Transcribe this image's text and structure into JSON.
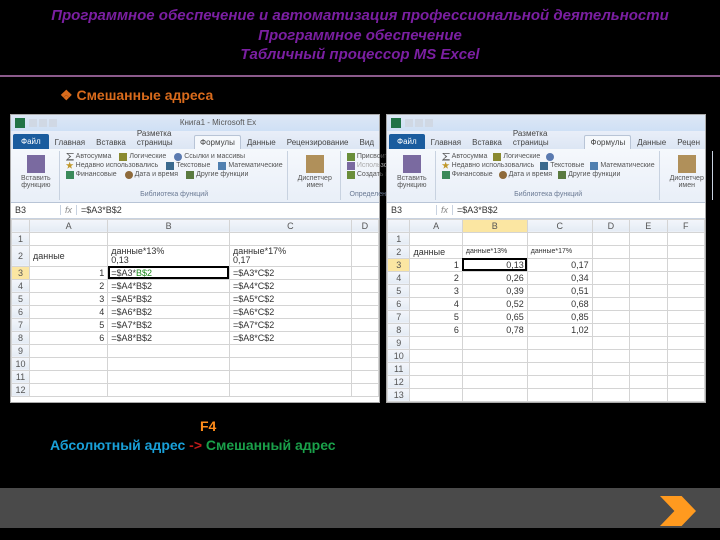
{
  "header": {
    "line1": "Программное обеспечение и автоматизация профессиональной деятельности",
    "line2": "Программное обеспечение",
    "line3": "Табличный процессор  MS Excel"
  },
  "subtitle": "Смешанные адреса",
  "excel_common": {
    "window_title": "Книга1 - Microsoft Ex",
    "tab_file": "Файл",
    "tabs": [
      "Главная",
      "Вставка",
      "Разметка страницы",
      "Формулы",
      "Данные",
      "Рецензирование",
      "Вид"
    ],
    "tabs_short": [
      "Главная",
      "Вставка",
      "Разметка страницы",
      "Формулы",
      "Данные",
      "Рецен"
    ],
    "active_tab": "Формулы",
    "ribbon": {
      "insert_fn": "Вставить\nфункцию",
      "autosum": "Автосумма",
      "recent": "Недавно использовались",
      "financial": "Финансовые",
      "logical": "Логические",
      "text": "Текстовые",
      "datetime": "Дата и время",
      "lookup": "Ссылки и массивы",
      "math": "Математические",
      "more": "Другие функции",
      "lib_label": "Библиотека функций",
      "name_mgr": "Диспетчер\nимен",
      "assign": "Присвоить",
      "use_in": "Использов",
      "create": "Создать из",
      "names_label": "Определенн"
    },
    "fx_label": "fx"
  },
  "left": {
    "namebox": "B3",
    "formula": "=$A3*B$2",
    "cols": [
      "",
      "A",
      "B",
      "C",
      "D"
    ],
    "rows": [
      {
        "r": "1",
        "a": "",
        "b": "",
        "c": "",
        "d": ""
      },
      {
        "r": "2",
        "a": "данные",
        "b": "данные*13%",
        "c": "данные*17%",
        "d": ""
      },
      {
        "r": "3",
        "a": "1",
        "b": "=$A3*B$2",
        "c": "=$A3*C$2",
        "d": ""
      },
      {
        "r": "4",
        "a": "2",
        "b": "=$A4*B$2",
        "c": "=$A4*C$2",
        "d": ""
      },
      {
        "r": "5",
        "a": "3",
        "b": "=$A5*B$2",
        "c": "=$A5*C$2",
        "d": ""
      },
      {
        "r": "6",
        "a": "4",
        "b": "=$A6*B$2",
        "c": "=$A6*C$2",
        "d": ""
      },
      {
        "r": "7",
        "a": "5",
        "b": "=$A7*B$2",
        "c": "=$A7*C$2",
        "d": ""
      },
      {
        "r": "8",
        "a": "6",
        "b": "=$A8*B$2",
        "c": "=$A8*C$2",
        "d": ""
      },
      {
        "r": "9",
        "a": "",
        "b": "",
        "c": "",
        "d": ""
      },
      {
        "r": "10",
        "a": "",
        "b": "",
        "c": "",
        "d": ""
      },
      {
        "r": "11",
        "a": "",
        "b": "",
        "c": "",
        "d": ""
      },
      {
        "r": "12",
        "a": "",
        "b": "",
        "c": "",
        "d": ""
      }
    ],
    "b2_extra": "0,13",
    "c2_extra": "0,17"
  },
  "right": {
    "namebox": "B3",
    "formula": "=$A3*B$2",
    "cols": [
      "",
      "A",
      "B",
      "C",
      "D",
      "E",
      "F"
    ],
    "rows": [
      {
        "r": "1",
        "a": "",
        "b": "",
        "c": "",
        "d": "",
        "e": "",
        "f": ""
      },
      {
        "r": "2",
        "a": "данные",
        "b": "данные*13%",
        "c": "данные*17%",
        "d": "",
        "e": "",
        "f": ""
      },
      {
        "r": "3",
        "a": "1",
        "b": "0,13",
        "c": "0,17",
        "d": "",
        "e": "",
        "f": ""
      },
      {
        "r": "4",
        "a": "2",
        "b": "0,26",
        "c": "0,34",
        "d": "",
        "e": "",
        "f": ""
      },
      {
        "r": "5",
        "a": "3",
        "b": "0,39",
        "c": "0,51",
        "d": "",
        "e": "",
        "f": ""
      },
      {
        "r": "6",
        "a": "4",
        "b": "0,52",
        "c": "0,68",
        "d": "",
        "e": "",
        "f": ""
      },
      {
        "r": "7",
        "a": "5",
        "b": "0,65",
        "c": "0,85",
        "d": "",
        "e": "",
        "f": ""
      },
      {
        "r": "8",
        "a": "6",
        "b": "0,78",
        "c": "1,02",
        "d": "",
        "e": "",
        "f": ""
      },
      {
        "r": "9",
        "a": "",
        "b": "",
        "c": "",
        "d": "",
        "e": "",
        "f": ""
      },
      {
        "r": "10",
        "a": "",
        "b": "",
        "c": "",
        "d": "",
        "e": "",
        "f": ""
      },
      {
        "r": "11",
        "a": "",
        "b": "",
        "c": "",
        "d": "",
        "e": "",
        "f": ""
      },
      {
        "r": "12",
        "a": "",
        "b": "",
        "c": "",
        "d": "",
        "e": "",
        "f": ""
      },
      {
        "r": "13",
        "a": "",
        "b": "",
        "c": "",
        "d": "",
        "e": "",
        "f": ""
      }
    ]
  },
  "footer": {
    "f4": "F4",
    "abs": "Абсолютный адрес",
    "arrow": "->",
    "mix": "Смешанный адрес"
  }
}
